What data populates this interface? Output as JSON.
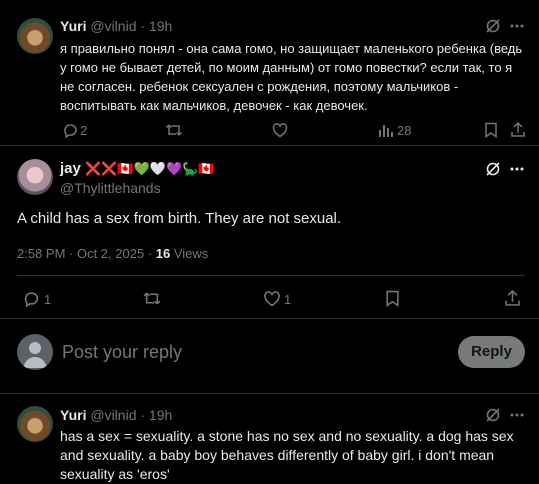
{
  "post1": {
    "name": "Yuri",
    "handle": "@vilnid",
    "time": "· 19h",
    "text": "я правильно понял - она сама гомо, но защищает маленького ребенка (ведь у гомо не бывает детей, по моим данным) от гомо повестки? если так, то я не согласен. ребенок сексуален с рождения, поэтому мальчиков - воспитывать как мальчиков, девочек - как девочек.",
    "replies": "2",
    "views": "28"
  },
  "post2": {
    "name": "jay",
    "name_emojis": "❌❌🇨🇦💚🤍💜🦕🇨🇦",
    "handle": "@Thylittlehands",
    "text": "A child has a sex from birth. They are not sexual.",
    "timestamp": "2:58 PM · Oct 2, 2025 · ",
    "views_count": "16",
    "views_label": " Views",
    "replies": "1",
    "likes": "1"
  },
  "composer": {
    "placeholder": "Post your reply",
    "button": "Reply"
  },
  "post3": {
    "name": "Yuri",
    "handle": "@vilnid",
    "time": "· 19h",
    "text": "has a sex = sexuality. a stone has no sex and no sexuality. a dog has sex and sexuality. a baby boy behaves differently of baby girl. i don't mean sexuality as 'eros'"
  },
  "icons": [
    "grok-icon",
    "more-icon",
    "reply-icon",
    "retweet-icon",
    "like-icon",
    "views-icon",
    "bookmark-icon",
    "share-icon"
  ]
}
